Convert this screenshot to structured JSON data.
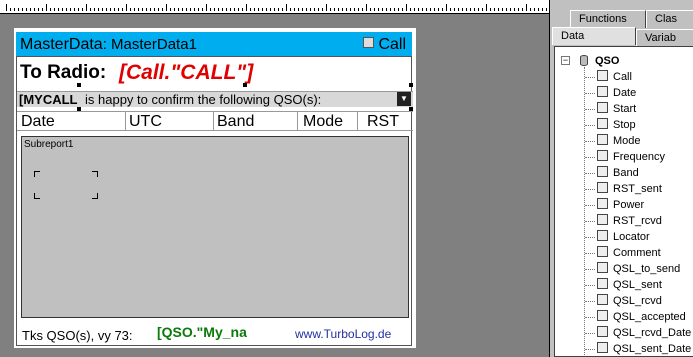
{
  "report": {
    "band_title": "MasterData",
    "band_name": ": MasterData1",
    "band_call": "Call",
    "to_radio": "To Radio:",
    "call_expression": "[Call.\"CALL\"]",
    "mycall": "[MYCALL",
    "confirm_text": "is happy to confirm the following QSO(s):",
    "columns": [
      "Date",
      "UTC",
      "Band",
      "Mode",
      "RST"
    ],
    "subreport_label": "Subreport1",
    "footer_tks": "Tks QSO(s),  vy 73:",
    "footer_qso_expr": "[QSO.\"My_na",
    "footer_site": "www.TurboLog.de"
  },
  "panel": {
    "tabs_top": [
      "Functions",
      "Clas"
    ],
    "tabs_bottom": [
      "Data",
      "Variab"
    ],
    "tree_root": "QSO",
    "fields": [
      "Call",
      "Date",
      "Start",
      "Stop",
      "Mode",
      "Frequency",
      "Band",
      "RST_sent",
      "Power",
      "RST_rcvd",
      "Locator",
      "Comment",
      "QSL_to_send",
      "QSL_sent",
      "QSL_rcvd",
      "QSL_accepted",
      "QSL_rcvd_Date",
      "QSL_sent_Date"
    ]
  }
}
